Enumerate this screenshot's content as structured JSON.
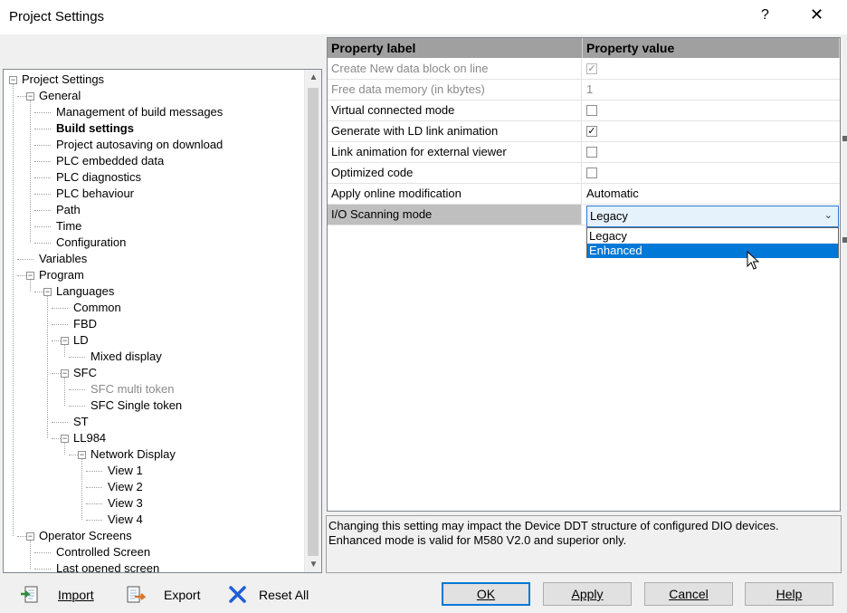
{
  "window": {
    "title": "Project Settings",
    "help": "?",
    "close": "✕"
  },
  "tree": [
    {
      "label": "Project Settings",
      "level": 0,
      "expander": "−",
      "style": ""
    },
    {
      "label": "General",
      "level": 1,
      "expander": "−",
      "style": ""
    },
    {
      "label": "Management of build messages",
      "level": 2,
      "expander": "",
      "style": ""
    },
    {
      "label": "Build settings",
      "level": 2,
      "expander": "",
      "style": "bold"
    },
    {
      "label": "Project autosaving on download",
      "level": 2,
      "expander": "",
      "style": ""
    },
    {
      "label": "PLC embedded data",
      "level": 2,
      "expander": "",
      "style": ""
    },
    {
      "label": "PLC diagnostics",
      "level": 2,
      "expander": "",
      "style": ""
    },
    {
      "label": "PLC behaviour",
      "level": 2,
      "expander": "",
      "style": ""
    },
    {
      "label": "Path",
      "level": 2,
      "expander": "",
      "style": ""
    },
    {
      "label": "Time",
      "level": 2,
      "expander": "",
      "style": ""
    },
    {
      "label": "Configuration",
      "level": 2,
      "expander": "",
      "style": ""
    },
    {
      "label": "Variables",
      "level": 1,
      "expander": "",
      "style": ""
    },
    {
      "label": "Program",
      "level": 1,
      "expander": "−",
      "style": ""
    },
    {
      "label": "Languages",
      "level": 2,
      "expander": "−",
      "style": ""
    },
    {
      "label": "Common",
      "level": 3,
      "expander": "",
      "style": ""
    },
    {
      "label": "FBD",
      "level": 3,
      "expander": "",
      "style": ""
    },
    {
      "label": "LD",
      "level": 3,
      "expander": "−",
      "style": ""
    },
    {
      "label": "Mixed display",
      "level": 4,
      "expander": "",
      "style": ""
    },
    {
      "label": "SFC",
      "level": 3,
      "expander": "−",
      "style": ""
    },
    {
      "label": "SFC multi token",
      "level": 4,
      "expander": "",
      "style": "dim"
    },
    {
      "label": "SFC Single token",
      "level": 4,
      "expander": "",
      "style": ""
    },
    {
      "label": "ST",
      "level": 3,
      "expander": "",
      "style": ""
    },
    {
      "label": "LL984",
      "level": 3,
      "expander": "−",
      "style": ""
    },
    {
      "label": "Network Display",
      "level": 4,
      "expander": "−",
      "style": ""
    },
    {
      "label": "View 1",
      "level": 5,
      "expander": "",
      "style": ""
    },
    {
      "label": "View 2",
      "level": 5,
      "expander": "",
      "style": ""
    },
    {
      "label": "View 3",
      "level": 5,
      "expander": "",
      "style": ""
    },
    {
      "label": "View 4",
      "level": 5,
      "expander": "",
      "style": ""
    },
    {
      "label": "Operator Screens",
      "level": 1,
      "expander": "−",
      "style": ""
    },
    {
      "label": "Controlled Screen",
      "level": 2,
      "expander": "",
      "style": ""
    },
    {
      "label": "Last opened screen",
      "level": 2,
      "expander": "",
      "style": ""
    }
  ],
  "grid": {
    "header_label": "Property label",
    "header_value": "Property value",
    "rows": [
      {
        "label": "Create New data block on line",
        "type": "check",
        "checked": true,
        "dim": true
      },
      {
        "label": "Free data memory (in kbytes)",
        "type": "text",
        "value": "1",
        "dim": true
      },
      {
        "label": "Virtual connected mode",
        "type": "check",
        "checked": false,
        "dim": false
      },
      {
        "label": "Generate with LD link animation",
        "type": "check",
        "checked": true,
        "dim": false
      },
      {
        "label": "Link animation for external viewer",
        "type": "check",
        "checked": false,
        "dim": false
      },
      {
        "label": "Optimized code",
        "type": "check",
        "checked": false,
        "dim": false
      },
      {
        "label": "Apply online modification",
        "type": "text",
        "value": "Automatic",
        "dim": false
      },
      {
        "label": "I/O Scanning mode",
        "type": "combo",
        "value": "Legacy",
        "dim": false
      }
    ],
    "combo_options": [
      "Legacy",
      "Enhanced"
    ],
    "combo_highlight": "Enhanced"
  },
  "description": {
    "line1": "Changing this setting may impact the Device DDT structure of configured DIO devices.",
    "line2": "Enhanced mode is valid for M580 V2.0 and superior only."
  },
  "toolbar": {
    "import_label": "Import",
    "export_label": "Export",
    "reset_label": "Reset All",
    "ok_label": "OK",
    "apply_label": "Apply",
    "cancel_label": "Cancel",
    "help_label": "Help"
  },
  "icons": {
    "import": "import-icon",
    "export": "export-icon",
    "reset": "reset-x-icon"
  },
  "colors": {
    "selection": "#0078d7",
    "header_bg": "#a0a0a0",
    "combo_border": "#2b79d6"
  }
}
